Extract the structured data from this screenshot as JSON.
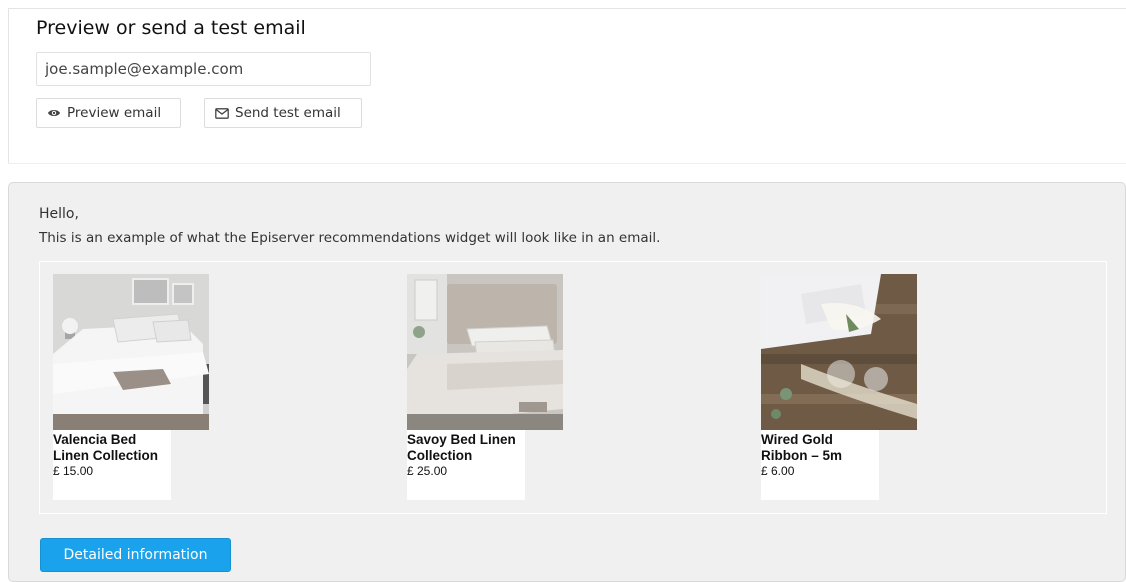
{
  "header": {
    "title": "Preview or send a test email",
    "email_value": "joe.sample@example.com",
    "preview_label": "Preview email",
    "send_label": "Send test email"
  },
  "preview": {
    "greeting": "Hello,",
    "intro": "This is an example of what the Episerver recommendations widget will look like in an email.",
    "products": [
      {
        "name": "Valencia Bed Linen Collection",
        "price": "£ 15.00"
      },
      {
        "name": "Savoy Bed Linen Collection",
        "price": "£ 25.00"
      },
      {
        "name": "Wired Gold Ribbon – 5m",
        "price": "£ 6.00"
      }
    ],
    "cta_label": "Detailed information"
  },
  "colors": {
    "accent": "#1aa3ec",
    "panel_bg": "#f0f0f0"
  },
  "icons": {
    "preview": "eye-icon",
    "send": "envelope-icon"
  }
}
